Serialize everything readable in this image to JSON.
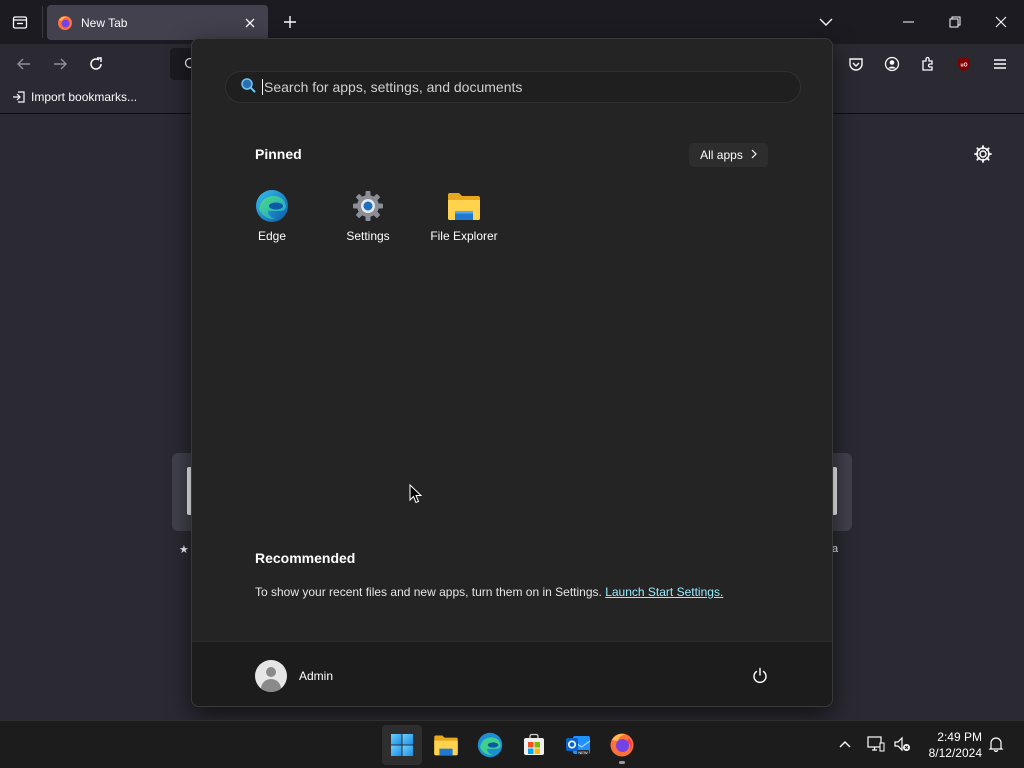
{
  "browser": {
    "tab": {
      "title": "New Tab"
    },
    "bookmarks": {
      "import_label": "Import bookmarks..."
    },
    "shortcut_left_label": "★",
    "shortcut_right_label": "a"
  },
  "start_menu": {
    "search": {
      "placeholder": "Search for apps, settings, and documents"
    },
    "pinned": {
      "title": "Pinned",
      "all_apps_label": "All apps",
      "apps": [
        {
          "label": "Edge",
          "icon": "edge-icon"
        },
        {
          "label": "Settings",
          "icon": "settings-gear-icon"
        },
        {
          "label": "File Explorer",
          "icon": "folder-icon"
        }
      ]
    },
    "recommended": {
      "title": "Recommended",
      "message": "To show your recent files and new apps, turn them on in Settings.",
      "link": "Launch Start Settings."
    },
    "user": {
      "name": "Admin"
    }
  },
  "taskbar": {
    "apps": [
      "start-icon",
      "file-explorer-icon",
      "edge-icon",
      "store-icon",
      "outlook-icon",
      "firefox-icon"
    ],
    "clock": {
      "time": "2:49 PM",
      "date": "8/12/2024"
    }
  },
  "colors": {
    "accent_link": "#99ebff",
    "start_bg": "#242424",
    "taskbar_bg": "#1c1c1c"
  }
}
